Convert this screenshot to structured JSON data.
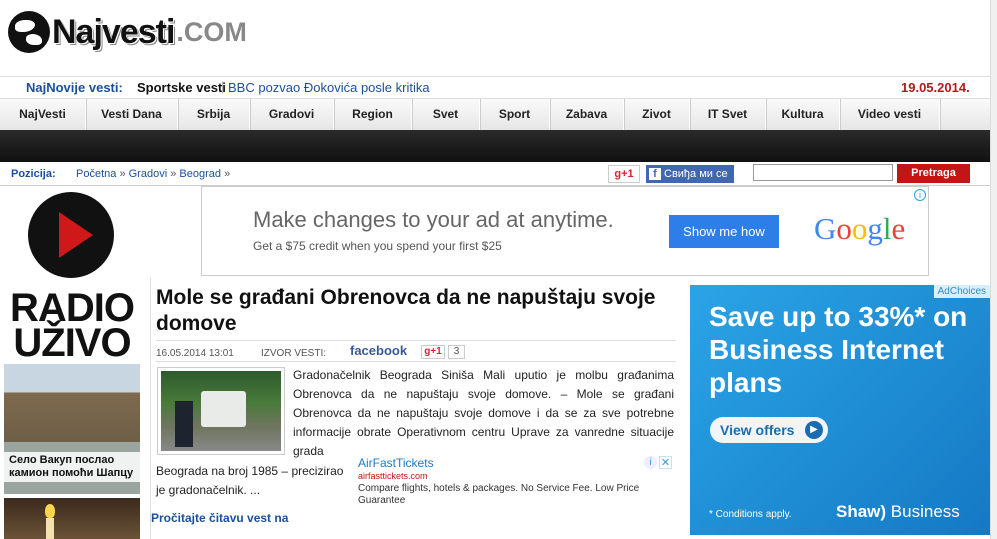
{
  "site": {
    "brand": "Najvesti",
    "tld": ".COM"
  },
  "ticker": {
    "label": "NajNovije vesti:",
    "category": "Sportske vesti",
    "separator": "|",
    "headline": "BBC pozvao Đokovića posle kritika",
    "date": "19.05.2014."
  },
  "nav": {
    "items": [
      "NajVesti",
      "Vesti Dana",
      "Srbija",
      "Gradovi",
      "Region",
      "Svet",
      "Sport",
      "Zabava",
      "Zivot",
      "IT Svet",
      "Kultura",
      "Video vesti"
    ]
  },
  "breadcrumb": {
    "label": "Pozicija:",
    "items": [
      "Početna",
      "Gradovi",
      "Beograd"
    ],
    "sep": "»"
  },
  "social": {
    "gplus": "g+1",
    "fb_like": "Свиђа ми се"
  },
  "search": {
    "placeholder": "",
    "button": "Pretraga"
  },
  "sidebar": {
    "radio_line1": "RADIO",
    "radio_line2": "UŽIVO",
    "thumb1_caption": "Село Вакуп послао камион помоћи Шапцу"
  },
  "top_ad": {
    "headline": "Make changes to your ad at anytime.",
    "sub": "Get a $75 credit when you spend your first $25",
    "button": "Show me how",
    "brand_letters": [
      "G",
      "o",
      "o",
      "g",
      "l",
      "e"
    ],
    "info": "i"
  },
  "article": {
    "title": "Mole se građani Obrenovca da ne napuštaju svoje domove",
    "date": "16.05.2014 13:01",
    "source": "IZVOR VESTI:",
    "fb": "facebook",
    "gplus": "g+1",
    "gplus_count": "3",
    "body1": "Gradonačelnik Beograda Siniša Mali uputio je molbu građanima Obrenovca da ne napuštaju svoje domove. – Mole se građani Obrenovca da ne napuštaju svoje domove i da se za sve potrebne informacije obrate Operativnom centru Uprave za vanredne situacije grada",
    "body2": "Beograda na broj 1985 – precizirao je gradonačelnik. ...",
    "read_more": "Pročitajte čitavu vest na"
  },
  "inline_ad": {
    "title": "AirFastTickets",
    "url": "airfasttickets.com",
    "desc": "Compare flights, hotels & packages. No Service Fee. Low Price Guarantee",
    "info": "i",
    "close": "✕"
  },
  "side_ad": {
    "adchoices": "AdChoices",
    "headline": "Save up to 33%* on Business Internet plans",
    "button": "View offers",
    "arrow": "▶",
    "fine": "* Conditions apply.",
    "logo_a": "Shaw)",
    "logo_b": "Business"
  }
}
